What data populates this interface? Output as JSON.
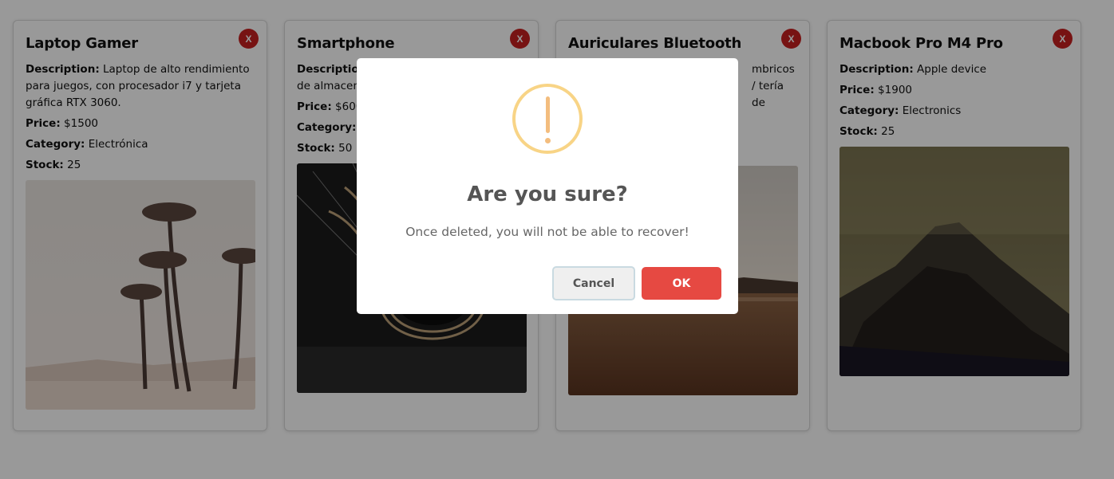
{
  "products": [
    {
      "title": "Laptop Gamer",
      "delete_label": "X",
      "description_label": "Description:",
      "description": "Laptop de alto rendimiento para juegos, con procesador i7 y tarjeta gráfica RTX 3060.",
      "price_label": "Price:",
      "price": "$1500",
      "category_label": "Category:",
      "category": "Electrónica",
      "stock_label": "Stock:",
      "stock": "25",
      "image": "palm-trees-photo"
    },
    {
      "title": "Smartphone",
      "delete_label": "X",
      "description_label": "Description:",
      "description": "pantalla AMOLED y 128GB de almacenamiento.",
      "price_label": "Price:",
      "price": "$600",
      "category_label": "Category:",
      "category": "",
      "stock_label": "Stock:",
      "stock": "50",
      "image": "steel-wool-fire-photo"
    },
    {
      "title": "Auriculares Bluetooth",
      "delete_label": "X",
      "description_label": "",
      "description": "mbricos / tería de",
      "price_label": "",
      "price": "",
      "category_label": "",
      "category": "",
      "stock_label": "",
      "stock": "",
      "image": "lake-sunset-photo"
    },
    {
      "title": "Macbook Pro M4 Pro",
      "delete_label": "X",
      "description_label": "Description:",
      "description": "Apple device",
      "price_label": "Price:",
      "price": "$1900",
      "category_label": "Category:",
      "category": "Electronics",
      "stock_label": "Stock:",
      "stock": "25",
      "image": "mountain-fog-photo"
    }
  ],
  "dialog": {
    "icon": "warning-icon",
    "title": "Are you sure?",
    "text": "Once deleted, you will not be able to recover!",
    "cancel_label": "Cancel",
    "ok_label": "OK"
  },
  "colors": {
    "delete_button": "#c62020",
    "ok_button": "#e64942",
    "warning": "#f8d486"
  }
}
